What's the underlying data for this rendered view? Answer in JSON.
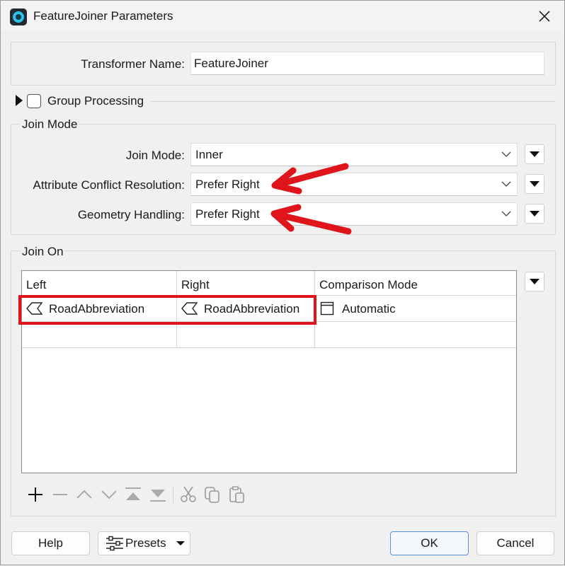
{
  "window": {
    "title": "FeatureJoiner Parameters",
    "icon": "fme-app-icon"
  },
  "transformer": {
    "label": "Transformer Name:",
    "value": "FeatureJoiner"
  },
  "group_processing": {
    "label": "Group Processing",
    "checked": false
  },
  "join_mode_section": {
    "title": "Join Mode",
    "join_mode_label": "Join Mode:",
    "join_mode_value": "Inner",
    "conflict_label": "Attribute Conflict Resolution:",
    "conflict_value": "Prefer Right",
    "geometry_label": "Geometry Handling:",
    "geometry_value": "Prefer Right"
  },
  "join_on_section": {
    "title": "Join On",
    "columns": [
      "Left",
      "Right",
      "Comparison Mode"
    ],
    "rows": [
      {
        "left": "RoadAbbreviation",
        "right": "RoadAbbreviation",
        "mode": "Automatic"
      }
    ]
  },
  "toolbar_icons": [
    "add-icon",
    "remove-icon",
    "move-up-icon",
    "move-down-icon",
    "move-top-icon",
    "move-bottom-icon",
    "cut-icon",
    "copy-icon",
    "paste-icon"
  ],
  "buttons": {
    "help": "Help",
    "presets": "Presets",
    "ok": "OK",
    "cancel": "Cancel"
  },
  "annotation_colors": {
    "arrow": "#e0141b",
    "highlight_box": "#e0141b"
  }
}
